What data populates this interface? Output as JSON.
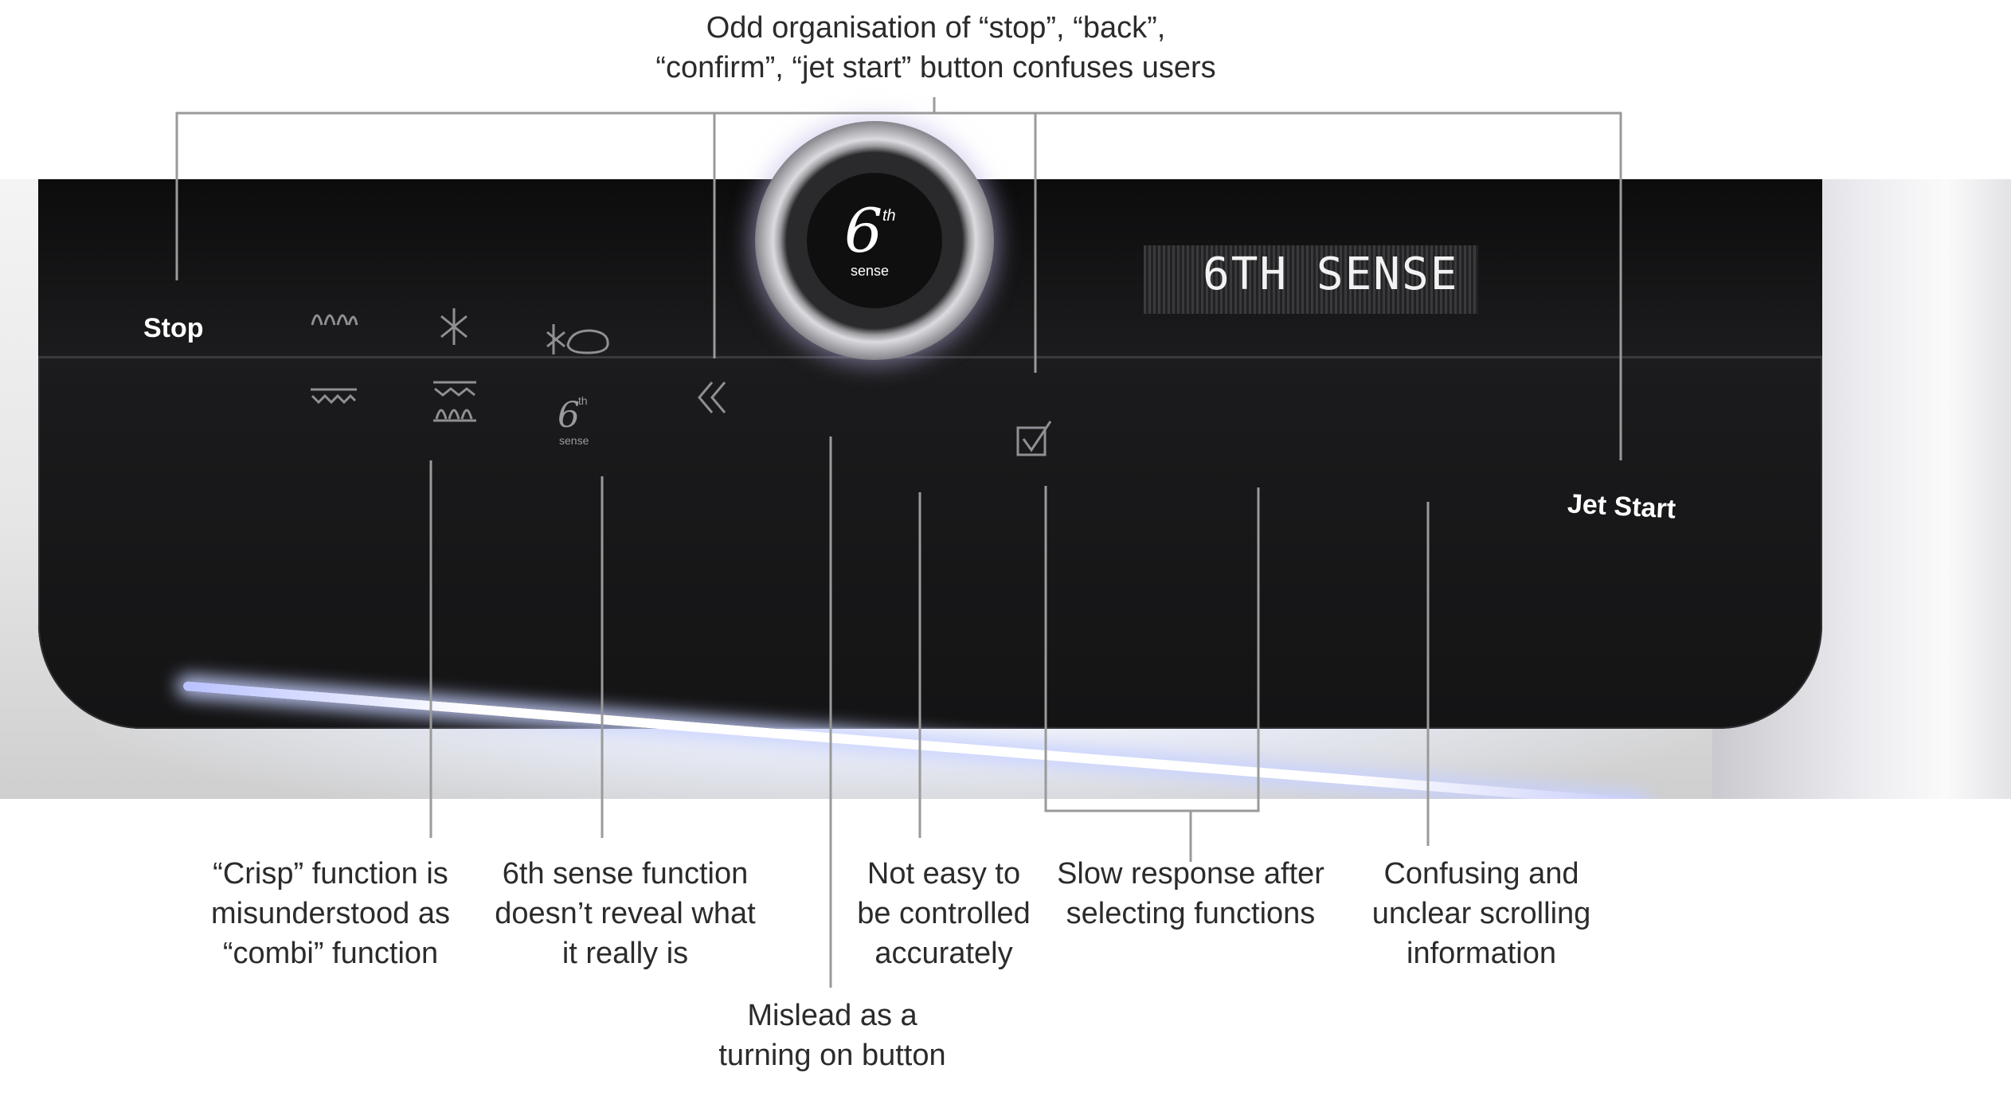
{
  "annotations": {
    "top": "Odd organisation of “stop”, “back”,\n“confirm”, “jet start” button confuses users",
    "crisp": "“Crisp” function is\nmisunderstood as\n“combi” function",
    "sixth_sense": "6th sense function\ndoesn’t reveal what\nit really is",
    "control": "Not easy to\nbe controlled\naccurately",
    "mislead": "Mislead as a\nturning on button",
    "slow": "Slow response after\nselecting functions",
    "scroll": "Confusing and\nunclear scrolling\ninformation"
  },
  "panel": {
    "stop_label": "Stop",
    "jet_start_label": "Jet Start",
    "display_text": "6TH SENSE",
    "dial_number": "6",
    "dial_superscript": "th",
    "dial_caption": "sense",
    "small_six": "6",
    "small_th": "th",
    "small_sense": "sense"
  },
  "icons": [
    "grill-icon",
    "defrost-icon",
    "defrost-bread-icon",
    "crisp-icon",
    "combi-icon",
    "sixth-sense-icon",
    "back-icon",
    "confirm-icon"
  ]
}
